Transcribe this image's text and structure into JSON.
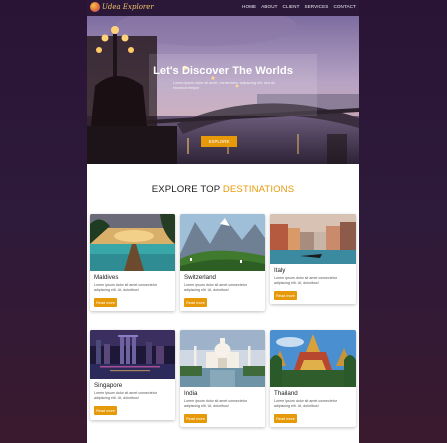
{
  "nav": {
    "logo_text": "Udea Explorer",
    "links": [
      "HOME",
      "ABOUT",
      "CLIENT",
      "SERVICES",
      "CONTACT"
    ]
  },
  "hero": {
    "title": "Let's Discover The Worlds",
    "subtitle": "Lorem ipsum dolor sit amet, consectetur adipiscing elit, sed do eiusmod tempor",
    "button": "EXPLORE"
  },
  "section": {
    "title_main": "EXPLORE TOP ",
    "title_accent": "DESTINATIONS"
  },
  "destinations": [
    {
      "name": "Maldives",
      "desc": "Lorem ipsum dolor sit amet consectetur adipiscing elit. Ut, doloribus!",
      "button": "Read more",
      "icon": "beach-pier-photo"
    },
    {
      "name": "Switzerland",
      "desc": "Lorem ipsum dolor sit amet consectetur adipiscing elit. Ut, doloribus!",
      "button": "Read more",
      "icon": "mountain-valley-photo"
    },
    {
      "name": "Italy",
      "desc": "Lorem ipsum dolor sit amet consectetur adipiscing elit. Ut, doloribus!",
      "button": "Read more",
      "icon": "venice-canal-photo"
    },
    {
      "name": "Singapore",
      "desc": "Lorem ipsum dolor sit amet consectetur adipiscing elit. Ut, doloribus!",
      "button": "Read more",
      "icon": "city-night-photo"
    },
    {
      "name": "India",
      "desc": "Lorem ipsum dolor sit amet consectetur adipiscing elit. Ut, doloribus!",
      "button": "Read more",
      "icon": "taj-mahal-photo"
    },
    {
      "name": "Thailand",
      "desc": "Lorem ipsum dolor sit amet consectetur adipiscing elit. Ut, doloribus!",
      "button": "Read more",
      "icon": "temple-photo"
    }
  ],
  "colors": {
    "accent": "#e69a0a",
    "nav_bg": "#2b1838"
  }
}
